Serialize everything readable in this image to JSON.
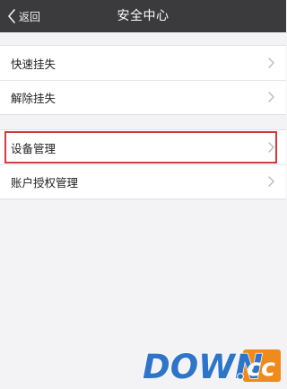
{
  "navbar": {
    "back_label": "返回",
    "title": "安全中心",
    "back_icon": "chevron-left-icon",
    "background": "#3b3b3d"
  },
  "groups": [
    {
      "items": [
        {
          "label": "快速挂失",
          "icon": "chevron-right-icon"
        },
        {
          "label": "解除挂失",
          "icon": "chevron-right-icon"
        }
      ]
    },
    {
      "items": [
        {
          "label": "设备管理",
          "icon": "chevron-right-icon",
          "highlighted": true
        },
        {
          "label": "账户授权管理",
          "icon": "chevron-right-icon"
        }
      ]
    }
  ],
  "watermark": {
    "text": "DOWN.cc",
    "accent": "#2e74c9",
    "cc_background": "#f08a1c"
  },
  "colors": {
    "highlight_outline": "#d23b3b",
    "page_background": "#f3f3f6"
  }
}
